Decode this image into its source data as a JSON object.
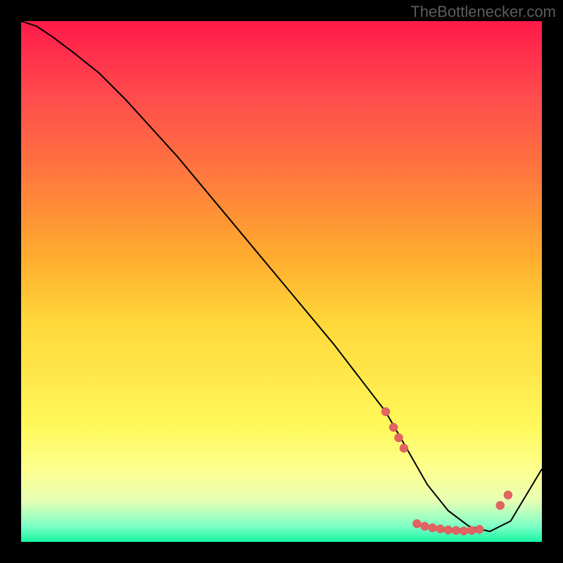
{
  "watermark": "TheBottlenecker.com",
  "chart_data": {
    "type": "line",
    "title": "",
    "xlabel": "",
    "ylabel": "",
    "xlim": [
      0,
      100
    ],
    "ylim": [
      0,
      100
    ],
    "series": [
      {
        "name": "curve",
        "x": [
          0,
          3,
          6,
          10,
          15,
          20,
          30,
          40,
          50,
          60,
          70,
          74,
          78,
          82,
          86,
          90,
          94,
          100
        ],
        "y": [
          100,
          99,
          97,
          94,
          90,
          85,
          74,
          62,
          50,
          38,
          25,
          18,
          11,
          6,
          3,
          2,
          4,
          14
        ]
      }
    ],
    "markers": {
      "name": "highlighted-points",
      "points": [
        {
          "x": 70,
          "y": 25
        },
        {
          "x": 71.5,
          "y": 22
        },
        {
          "x": 72.5,
          "y": 20
        },
        {
          "x": 73.5,
          "y": 18
        },
        {
          "x": 76,
          "y": 3.5
        },
        {
          "x": 77.5,
          "y": 3
        },
        {
          "x": 79,
          "y": 2.7
        },
        {
          "x": 80.5,
          "y": 2.5
        },
        {
          "x": 82,
          "y": 2.3
        },
        {
          "x": 83.5,
          "y": 2.2
        },
        {
          "x": 85,
          "y": 2.1
        },
        {
          "x": 86.5,
          "y": 2.2
        },
        {
          "x": 88,
          "y": 2.4
        },
        {
          "x": 92,
          "y": 7
        },
        {
          "x": 93.5,
          "y": 9
        }
      ]
    },
    "background": {
      "type": "vertical-gradient",
      "stops": [
        {
          "pos": 0,
          "color": "#ff1a4a"
        },
        {
          "pos": 50,
          "color": "#ffd83a"
        },
        {
          "pos": 100,
          "color": "#18f5a3"
        }
      ]
    }
  }
}
